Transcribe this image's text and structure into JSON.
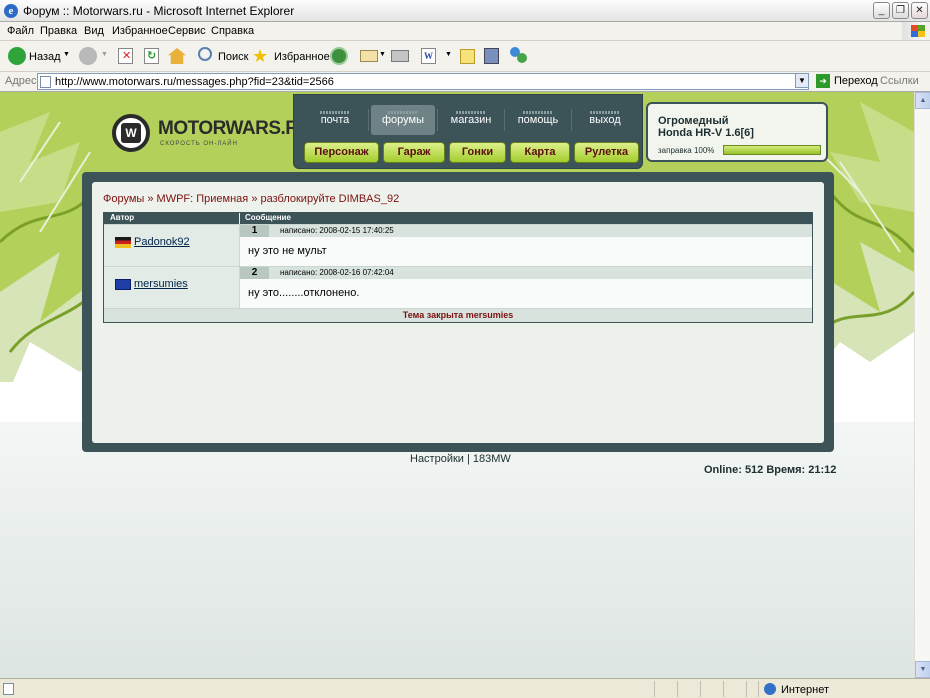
{
  "window": {
    "title": "Форум :: Motorwars.ru - Microsoft Internet Explorer"
  },
  "menu": [
    "Файл",
    "Правка",
    "Вид",
    "Избранное",
    "Сервис",
    "Справка"
  ],
  "toolbar": {
    "back": "Назад",
    "search": "Поиск",
    "favorites": "Избранное"
  },
  "address": {
    "label": "Адрес:",
    "url": "http://www.motorwars.ru/messages.php?fid=23&tid=2566",
    "go": "Переход",
    "links": "Ссылки"
  },
  "site": {
    "logo": "MOTORWARS.RU",
    "logo_sub": "СКОРОСТЬ ОН-ЛАЙН",
    "nav": [
      "почта",
      "форумы",
      "магазин",
      "помощь",
      "выход"
    ],
    "buttons": [
      "Персонаж",
      "Гараж",
      "Гонки",
      "Карта",
      "Рулетка"
    ],
    "car": {
      "line1": "Огромедный",
      "line2": "Honda HR-V 1.6[6]",
      "fuel_label": "заправка 100%",
      "fuel_level": 1.0
    }
  },
  "forum": {
    "breadcrumb": "Форумы » MWPF: Приемная » разблокируйте DIMBAS_92",
    "col_author": "Автор",
    "col_message": "Сообщение",
    "posts": [
      {
        "num": "1",
        "author": "Padonok92",
        "date": "написано: 2008-02-15 17:40:25",
        "text": "ну это не мульт"
      },
      {
        "num": "2",
        "author": "mersumies",
        "date": "написано: 2008-02-16 07:42:04",
        "text": "ну это........отклонено."
      }
    ],
    "closed": "Тема закрыта mersumies"
  },
  "footer": {
    "links": "Настройки | 183MW",
    "online": "Online: 512  Время: 21:12"
  },
  "status": {
    "zone": "Интернет"
  }
}
